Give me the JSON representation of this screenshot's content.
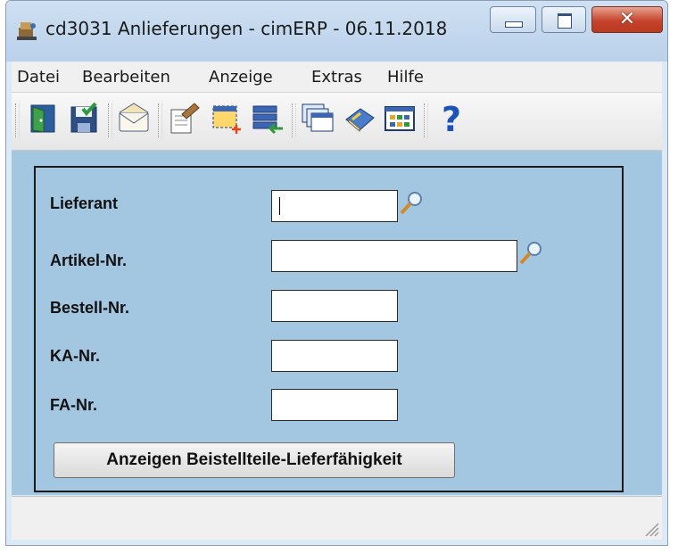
{
  "window": {
    "title": "cd3031 Anlieferungen - cimERP - 06.11.2018",
    "controls": {
      "minimize": "minimize-icon",
      "maximize": "maximize-icon",
      "close": "close-icon"
    }
  },
  "menu": [
    "Datei",
    "Bearbeiten",
    "Anzeige",
    "Extras",
    "Hilfe"
  ],
  "toolbar": [
    "exit-door-icon",
    "save-icon",
    "mail-icon",
    "edit-document-icon",
    "new-selection-icon",
    "import-list-icon",
    "windows-icon",
    "book-icon",
    "grid-view-icon",
    "help-icon"
  ],
  "form": {
    "fields": [
      {
        "label": "Lieferant",
        "value": "",
        "has_search": true
      },
      {
        "label": "Artikel-Nr.",
        "value": "",
        "has_search": true
      },
      {
        "label": "Bestell-Nr.",
        "value": "",
        "has_search": false
      },
      {
        "label": "KA-Nr.",
        "value": "",
        "has_search": false
      },
      {
        "label": "FA-Nr.",
        "value": "",
        "has_search": false
      }
    ],
    "button": "Anzeigen Beistellteile-Lieferfähigkeit"
  },
  "colors": {
    "form_background": "#a3c6e1",
    "chrome": "#f0f0f0",
    "close_button": "#c5442b"
  }
}
